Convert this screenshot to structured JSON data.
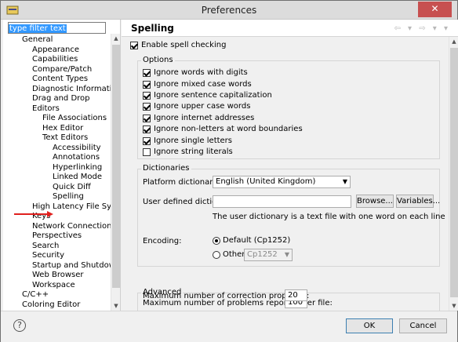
{
  "window": {
    "title": "Preferences",
    "close_label": "✕",
    "app_icon": "eclipse-icon"
  },
  "filter": {
    "text": "type filter text"
  },
  "tree": [
    {
      "label": "General"
    },
    {
      "label": "Appearance"
    },
    {
      "label": "Capabilities"
    },
    {
      "label": "Compare/Patch"
    },
    {
      "label": "Content Types"
    },
    {
      "label": "Diagnostic Information"
    },
    {
      "label": "Drag and Drop"
    },
    {
      "label": "Editors"
    },
    {
      "label": "File Associations"
    },
    {
      "label": "Hex Editor"
    },
    {
      "label": "Text Editors"
    },
    {
      "label": "Accessibility"
    },
    {
      "label": "Annotations"
    },
    {
      "label": "Hyperlinking"
    },
    {
      "label": "Linked Mode"
    },
    {
      "label": "Quick Diff"
    },
    {
      "label": "Spelling"
    },
    {
      "label": "High Latency File System"
    },
    {
      "label": "Keys"
    },
    {
      "label": "Network Connections"
    },
    {
      "label": "Perspectives"
    },
    {
      "label": "Search"
    },
    {
      "label": "Security"
    },
    {
      "label": "Startup and Shutdown"
    },
    {
      "label": "Web Browser"
    },
    {
      "label": "Workspace"
    },
    {
      "label": "C/C++"
    },
    {
      "label": "Coloring Editor"
    }
  ],
  "page": {
    "title": "Spelling",
    "nav_icons": "⇦ ▾ ⇨ ▾ ▾",
    "enable_label": "Enable spell checking",
    "enable_checked": true,
    "options_title": "Options",
    "options": [
      {
        "label": "Ignore words with digits",
        "checked": true
      },
      {
        "label": "Ignore mixed case words",
        "checked": true
      },
      {
        "label": "Ignore sentence capitalization",
        "checked": true
      },
      {
        "label": "Ignore upper case words",
        "checked": true
      },
      {
        "label": "Ignore internet addresses",
        "checked": true
      },
      {
        "label": "Ignore non-letters at word boundaries",
        "checked": true
      },
      {
        "label": "Ignore single letters",
        "checked": true
      },
      {
        "label": "Ignore string literals",
        "checked": false
      }
    ],
    "dictionaries_title": "Dictionaries",
    "platform_dict_label": "Platform dictionary:",
    "platform_dict_value": "English (United Kingdom)",
    "user_dict_label": "User defined dictionary:",
    "user_dict_value": "",
    "browse_label": "Browse...",
    "variables_label": "Variables...",
    "user_dict_hint": "The user dictionary is a text file with one word on each line",
    "encoding_label": "Encoding:",
    "encoding_default_label": "Default (Cp1252)",
    "encoding_other_label": "Other:",
    "encoding_other_value": "Cp1252",
    "advanced_title": "Advanced",
    "max_problems_label": "Maximum number of problems reported per file:",
    "max_problems_value": "100",
    "max_proposals_label": "Maximum number of correction proposals:",
    "max_proposals_value": "20"
  },
  "bottom": {
    "ok_label": "OK",
    "cancel_label": "Cancel",
    "help_label": "?"
  },
  "colors": {
    "accent": "#3399ff",
    "close": "#c75050",
    "annotation_arrow": "#e0201e"
  }
}
